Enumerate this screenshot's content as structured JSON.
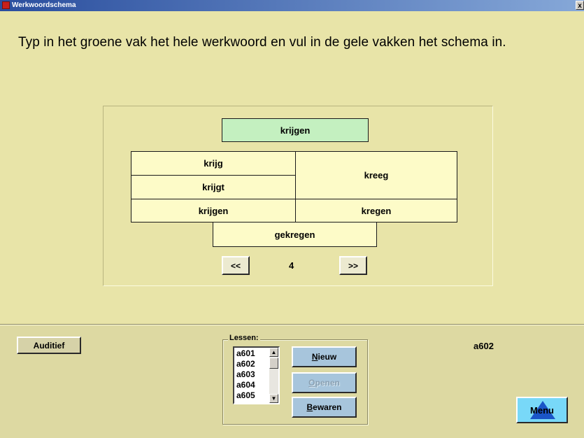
{
  "window": {
    "title": "Werkwoordschema",
    "close_glyph": "x"
  },
  "instruction": "Typ in het groene vak het hele werkwoord en vul in de gele vakken het schema in.",
  "schema": {
    "infinitive": "krijgen",
    "present_ik": "krijg",
    "present_hij": "krijgt",
    "present_plural": "krijgen",
    "past_singular": "kreeg",
    "past_plural": "kregen",
    "participle": "gekregen"
  },
  "navigation": {
    "prev_label": "<<",
    "next_label": ">>",
    "page": "4"
  },
  "buttons": {
    "auditief": "Auditief",
    "nieuw": {
      "first": "N",
      "rest": "ieuw"
    },
    "openen": {
      "first": "O",
      "rest": "penen"
    },
    "bewaren": {
      "first": "B",
      "rest": "ewaren"
    },
    "menu": {
      "text": "Menu",
      "icon": "triangle-up-icon"
    }
  },
  "lessons": {
    "label": "Lessen:",
    "items": [
      "a601",
      "a602",
      "a603",
      "a604",
      "a605"
    ],
    "current": "a602"
  },
  "colors": {
    "background": "#e8e4a8",
    "yellow_cell": "#fdfbc8",
    "green_cell": "#c4f0c0",
    "blue_button": "#a7c5dc",
    "menu_button": "#78d8f8",
    "titlebar": "#2a4e9e"
  }
}
